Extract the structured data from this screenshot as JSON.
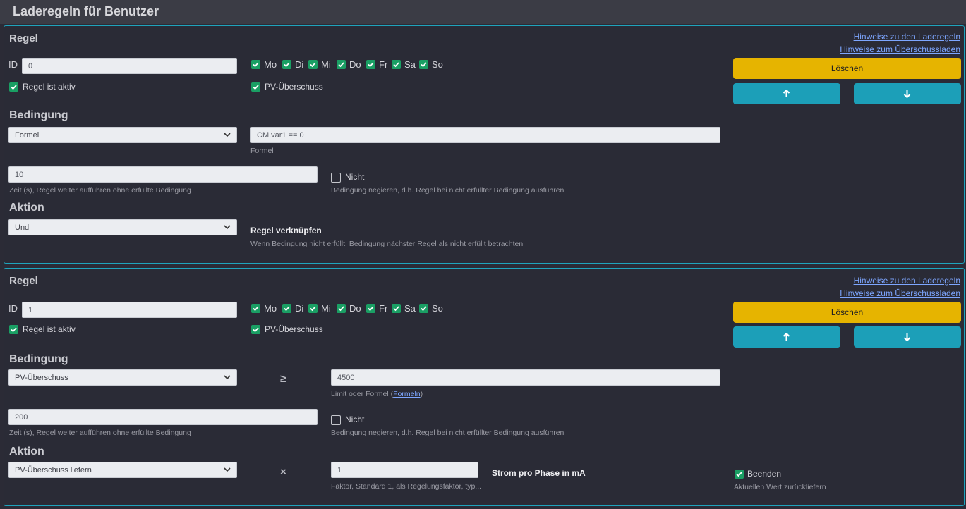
{
  "page": {
    "title": "Laderegeln für Benutzer"
  },
  "days": [
    "Mo",
    "Di",
    "Mi",
    "Do",
    "Fr",
    "Sa",
    "So"
  ],
  "rules": [
    {
      "heading": "Regel",
      "link_laderegeln": "Hinweise zu den Laderegeln",
      "link_ueberschuss": "Hinweise zum Überschussladen",
      "id_label": "ID",
      "id_value": "0",
      "active_label": "Regel ist aktiv",
      "pv_label": "PV-Überschuss",
      "delete_label": "Löschen",
      "bedingung_heading": "Bedingung",
      "condition_select": "Formel",
      "formula_value": "CM.var1 == 0",
      "formula_caption": "Formel",
      "time_value": "10",
      "time_caption": "Zeit (s), Regel weiter aufführen ohne erfüllte Bedingung",
      "not_label": "Nicht",
      "not_caption": "Bedingung negieren, d.h. Regel bei nicht erfüllter Bedingung ausführen",
      "aktion_heading": "Aktion",
      "action_select": "Und",
      "link_title": "Regel verknüpfen",
      "link_caption": "Wenn Bedingung nicht erfüllt, Bedingung nächster Regel als nicht erfüllt betrachten"
    },
    {
      "heading": "Regel",
      "link_laderegeln": "Hinweise zu den Laderegeln",
      "link_ueberschuss": "Hinweise zum Überschussladen",
      "id_label": "ID",
      "id_value": "1",
      "active_label": "Regel ist aktiv",
      "pv_label": "PV-Überschuss",
      "delete_label": "Löschen",
      "bedingung_heading": "Bedingung",
      "condition_select": "PV-Überschuss",
      "operator": "≥",
      "limit_value": "4500",
      "limit_caption_prefix": "Limit oder Formel (",
      "limit_caption_link": "Formeln",
      "limit_caption_suffix": ")",
      "time_value": "200",
      "time_caption": "Zeit (s), Regel weiter aufführen ohne erfüllte Bedingung",
      "not_label": "Nicht",
      "not_caption": "Bedingung negieren, d.h. Regel bei nicht erfüllter Bedingung ausführen",
      "aktion_heading": "Aktion",
      "action_select": "PV-Überschuss liefern",
      "action_operator": "×",
      "factor_value": "1",
      "factor_caption": "Faktor, Standard 1, als Regelungsfaktor, typ...",
      "current_label": "Strom pro Phase in mA",
      "end_label": "Beenden",
      "end_caption": "Aktuellen Wert zurückliefern"
    }
  ]
}
